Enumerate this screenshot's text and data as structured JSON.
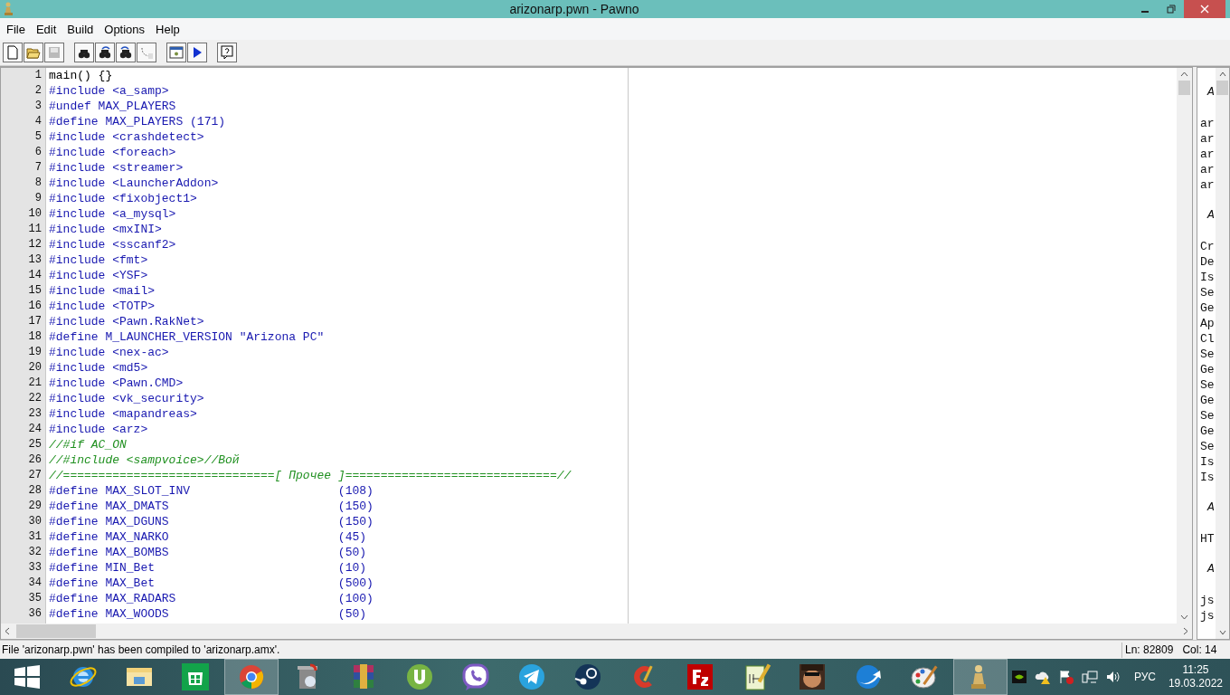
{
  "window": {
    "title": "arizonarp.pwn - Pawno"
  },
  "menu": [
    "File",
    "Edit",
    "Build",
    "Options",
    "Help"
  ],
  "toolbar": [
    {
      "kind": "new",
      "disabled": false
    },
    {
      "kind": "open",
      "disabled": false
    },
    {
      "kind": "save",
      "disabled": true
    },
    {
      "kind": "find",
      "disabled": false
    },
    {
      "kind": "findnext",
      "disabled": false
    },
    {
      "kind": "findprev",
      "disabled": false
    },
    {
      "kind": "goto",
      "disabled": false
    },
    {
      "kind": "compile",
      "disabled": false
    },
    {
      "kind": "run",
      "disabled": false
    },
    {
      "kind": "help",
      "disabled": false
    }
  ],
  "editor": {
    "lines": [
      {
        "number": "1",
        "text": "main() {}",
        "kind": "plain"
      },
      {
        "number": "2",
        "text": "#include <a_samp>",
        "kind": "directive"
      },
      {
        "number": "3",
        "text": "#undef MAX_PLAYERS",
        "kind": "directive"
      },
      {
        "number": "4",
        "text": "#define MAX_PLAYERS (171)",
        "kind": "directive"
      },
      {
        "number": "5",
        "text": "#include <crashdetect>",
        "kind": "directive"
      },
      {
        "number": "6",
        "text": "#include <foreach>",
        "kind": "directive"
      },
      {
        "number": "7",
        "text": "#include <streamer>",
        "kind": "directive"
      },
      {
        "number": "8",
        "text": "#include <LauncherAddon>",
        "kind": "directive"
      },
      {
        "number": "9",
        "text": "#include <fixobject1>",
        "kind": "directive"
      },
      {
        "number": "10",
        "text": "#include <a_mysql>",
        "kind": "directive"
      },
      {
        "number": "11",
        "text": "#include <mxINI>",
        "kind": "directive"
      },
      {
        "number": "12",
        "text": "#include <sscanf2>",
        "kind": "directive"
      },
      {
        "number": "13",
        "text": "#include <fmt>",
        "kind": "directive"
      },
      {
        "number": "14",
        "text": "#include <YSF>",
        "kind": "directive"
      },
      {
        "number": "15",
        "text": "#include <mail>",
        "kind": "directive"
      },
      {
        "number": "16",
        "text": "#include <TOTP>",
        "kind": "directive"
      },
      {
        "number": "17",
        "text": "#include <Pawn.RakNet>",
        "kind": "directive"
      },
      {
        "number": "18",
        "text": "#define M_LAUNCHER_VERSION \"Arizona PC\"",
        "kind": "directive"
      },
      {
        "number": "19",
        "text": "#include <nex-ac>",
        "kind": "directive"
      },
      {
        "number": "20",
        "text": "#include <md5>",
        "kind": "directive"
      },
      {
        "number": "21",
        "text": "#include <Pawn.CMD>",
        "kind": "directive"
      },
      {
        "number": "22",
        "text": "#include <vk_security>",
        "kind": "directive"
      },
      {
        "number": "23",
        "text": "#include <mapandreas>",
        "kind": "directive"
      },
      {
        "number": "24",
        "text": "#include <arz>",
        "kind": "directive"
      },
      {
        "number": "25",
        "text": "//#if AC_ON",
        "kind": "comment"
      },
      {
        "number": "26",
        "text": "//#include <sampvoice>//Вой",
        "kind": "comment"
      },
      {
        "number": "27",
        "text": "//==============================[ Прочее ]==============================//",
        "kind": "comment"
      },
      {
        "number": "28",
        "text": "#define MAX_SLOT_INV                     (108)",
        "kind": "directive"
      },
      {
        "number": "29",
        "text": "#define MAX_DMATS                        (150)",
        "kind": "directive"
      },
      {
        "number": "30",
        "text": "#define MAX_DGUNS                        (150)",
        "kind": "directive"
      },
      {
        "number": "31",
        "text": "#define MAX_NARKO                        (45)",
        "kind": "directive"
      },
      {
        "number": "32",
        "text": "#define MAX_BOMBS                        (50)",
        "kind": "directive"
      },
      {
        "number": "33",
        "text": "#define MIN_Bet                          (10)",
        "kind": "directive"
      },
      {
        "number": "34",
        "text": "#define MAX_Bet                          (500)",
        "kind": "directive"
      },
      {
        "number": "35",
        "text": "#define MAX_RADARS                       (100)",
        "kind": "directive"
      },
      {
        "number": "36",
        "text": "#define MAX_WOODS                        (50)",
        "kind": "directive"
      }
    ]
  },
  "function_list": [
    {
      "text": "A",
      "kind": "heading"
    },
    {
      "text": "ar",
      "kind": "item"
    },
    {
      "text": "ar",
      "kind": "item"
    },
    {
      "text": "ar",
      "kind": "item"
    },
    {
      "text": "ar",
      "kind": "item"
    },
    {
      "text": "ar",
      "kind": "item"
    },
    {
      "text": "A",
      "kind": "heading"
    },
    {
      "text": "Cr",
      "kind": "item"
    },
    {
      "text": "De",
      "kind": "item"
    },
    {
      "text": "Is",
      "kind": "item"
    },
    {
      "text": "Se",
      "kind": "item"
    },
    {
      "text": "Ge",
      "kind": "item"
    },
    {
      "text": "Ap",
      "kind": "item"
    },
    {
      "text": "Cl",
      "kind": "item"
    },
    {
      "text": "Se",
      "kind": "item"
    },
    {
      "text": "Ge",
      "kind": "item"
    },
    {
      "text": "Se",
      "kind": "item"
    },
    {
      "text": "Ge",
      "kind": "item"
    },
    {
      "text": "Se",
      "kind": "item"
    },
    {
      "text": "Ge",
      "kind": "item"
    },
    {
      "text": "Se",
      "kind": "item"
    },
    {
      "text": "Is",
      "kind": "item"
    },
    {
      "text": "Is",
      "kind": "item"
    },
    {
      "text": "A",
      "kind": "heading"
    },
    {
      "text": "HT",
      "kind": "item"
    },
    {
      "text": "A",
      "kind": "heading"
    },
    {
      "text": "js",
      "kind": "item"
    },
    {
      "text": "js",
      "kind": "item"
    }
  ],
  "status_bar": {
    "message": "File 'arizonarp.pwn' has been compiled to 'arizonarp.amx'.",
    "line": "Ln: 82809",
    "column": "Col: 14"
  },
  "taskbar": {
    "apps": [
      {
        "kind": "start",
        "selected": false
      },
      {
        "kind": "ie",
        "selected": false
      },
      {
        "kind": "explorer",
        "selected": false
      },
      {
        "kind": "store",
        "selected": false
      },
      {
        "kind": "chrome",
        "selected": true
      },
      {
        "kind": "recycle",
        "selected": false
      },
      {
        "kind": "archive",
        "selected": false
      },
      {
        "kind": "torrent",
        "selected": false
      },
      {
        "kind": "viber",
        "selected": false
      },
      {
        "kind": "telegram",
        "selected": false
      },
      {
        "kind": "steam",
        "selected": false
      },
      {
        "kind": "cleaner",
        "selected": false
      },
      {
        "kind": "filezilla",
        "selected": false
      },
      {
        "kind": "notepad",
        "selected": false
      },
      {
        "kind": "game",
        "selected": false
      },
      {
        "kind": "sync",
        "selected": false
      },
      {
        "kind": "paint",
        "selected": false
      },
      {
        "kind": "pawn",
        "selected": true
      }
    ],
    "tray": [
      {
        "kind": "nvidia"
      },
      {
        "kind": "cloud"
      },
      {
        "kind": "flag"
      },
      {
        "kind": "network"
      },
      {
        "kind": "volume"
      }
    ],
    "language": "РУС",
    "time": "11:25",
    "date": "19.03.2022"
  }
}
